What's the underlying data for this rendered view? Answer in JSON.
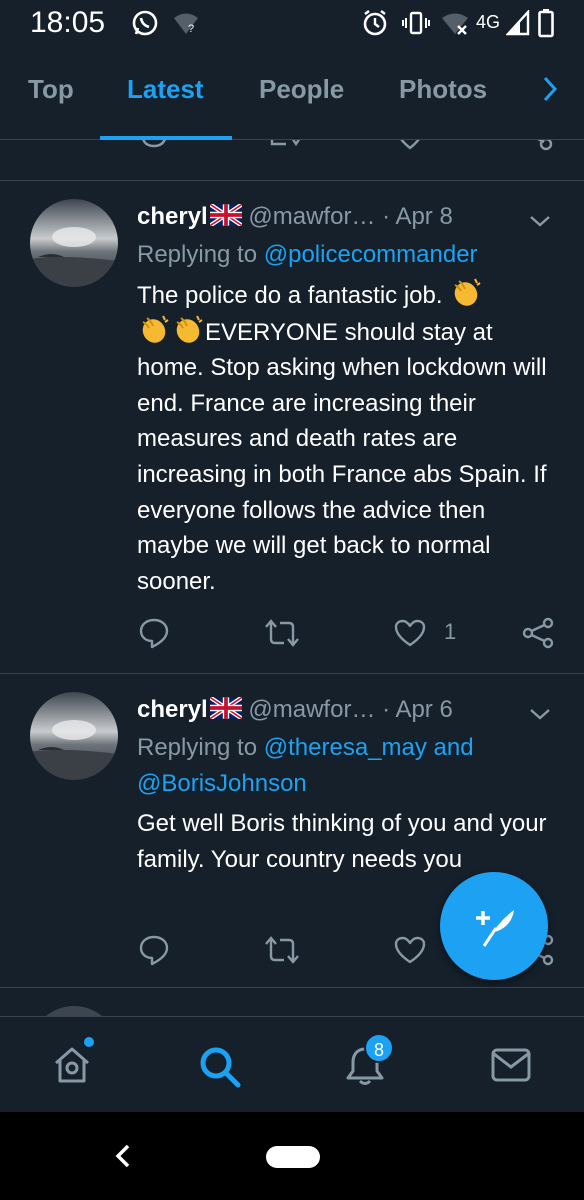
{
  "status_bar": {
    "time": "18:05",
    "network": "4G",
    "icons": [
      "whatsapp-icon",
      "wifi-unknown-icon",
      "alarm-icon",
      "vibrate-icon",
      "wifi-off-icon",
      "signal-icon",
      "battery-icon"
    ]
  },
  "tabs": [
    {
      "label": "Top"
    },
    {
      "label": "Latest"
    },
    {
      "label": "People"
    },
    {
      "label": "Photos"
    }
  ],
  "tweets": [
    {
      "name": "cheryl",
      "handle": "@mawfor…",
      "date": "· Apr 8",
      "replying_prefix": "Replying to ",
      "replying_to": "@policecommander",
      "text_1": "The police do a fantastic job.",
      "text_2": "EVERYONE should stay at home. Stop asking when lockdown will end. France are increasing their measures and death rates are increasing in both France abs Spain. If everyone follows the advice then maybe we will get back to normal sooner.",
      "likes": "1"
    },
    {
      "name": "cheryl",
      "handle": "@mawfor…",
      "date": "· Apr 6",
      "replying_prefix": "Replying to ",
      "replying_to": "@theresa_may and",
      "replying_to_2": "@BorisJohnson",
      "text": "Get well Boris thinking of you and your family. Your country needs you"
    }
  ],
  "bottom_nav": {
    "notifications_badge": "8"
  },
  "colors": {
    "background": "#15202b",
    "accent": "#1da1f2",
    "muted": "#8899a6",
    "divider": "#38444d"
  }
}
